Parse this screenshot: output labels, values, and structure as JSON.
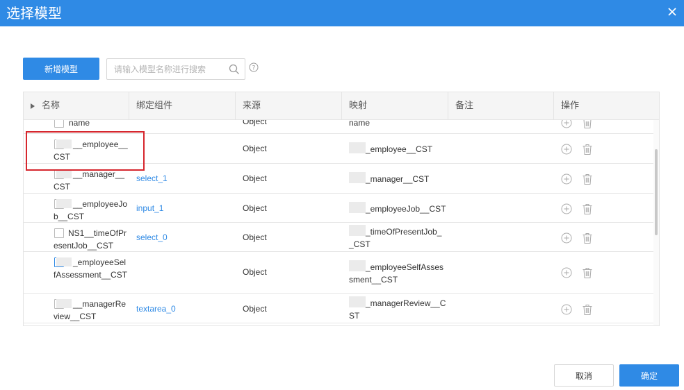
{
  "dialog": {
    "title": "选择模型",
    "close_icon": "close-icon"
  },
  "toolbar": {
    "add_label": "新增模型",
    "search_placeholder": "请输入模型名称进行搜索",
    "search_value": "",
    "search_icon": "search-icon",
    "help_icon": "help-icon"
  },
  "table": {
    "columns": [
      "名称",
      "绑定组件",
      "来源",
      "映射",
      "备注",
      "操作"
    ],
    "rows": [
      {
        "name_masked": false,
        "name": "name",
        "checked": false,
        "component": "",
        "source": "Object",
        "mapping_masked": false,
        "mapping": "name"
      },
      {
        "name_masked": true,
        "name": "__employee__CST",
        "checked": false,
        "component": "",
        "source": "Object",
        "mapping_masked": true,
        "mapping": "_employee__CST"
      },
      {
        "name_masked": true,
        "name": "__manager__CST",
        "checked": false,
        "component": "select_1",
        "source": "Object",
        "mapping_masked": true,
        "mapping": "_manager__CST"
      },
      {
        "name_masked": true,
        "name": "__employeeJob__CST",
        "checked": false,
        "component": "input_1",
        "source": "Object",
        "mapping_masked": true,
        "mapping": "_employeeJob__CST"
      },
      {
        "name_masked": false,
        "name": "NS1__timeOfPresentJob__CST",
        "checked": false,
        "component": "select_0",
        "source": "Object",
        "mapping_masked": true,
        "mapping": "_timeOfPresentJob__CST"
      },
      {
        "name_masked": true,
        "name": "_employeeSelfAssessment__CST",
        "checked": true,
        "component": "",
        "source": "Object",
        "mapping_masked": true,
        "mapping": "_employeeSelfAssessment__CST"
      },
      {
        "name_masked": true,
        "name": "__managerReview__CST",
        "checked": false,
        "component": "textarea_0",
        "source": "Object",
        "mapping_masked": true,
        "mapping": "_managerReview__CST"
      }
    ],
    "row_actions": {
      "add_icon": "plus-circle-icon",
      "delete_icon": "trash-icon"
    }
  },
  "footer": {
    "cancel_label": "取消",
    "ok_label": "确定"
  },
  "colors": {
    "primary": "#2f8ae5",
    "link": "#2f8ae5",
    "highlight_border": "#d6262d"
  }
}
